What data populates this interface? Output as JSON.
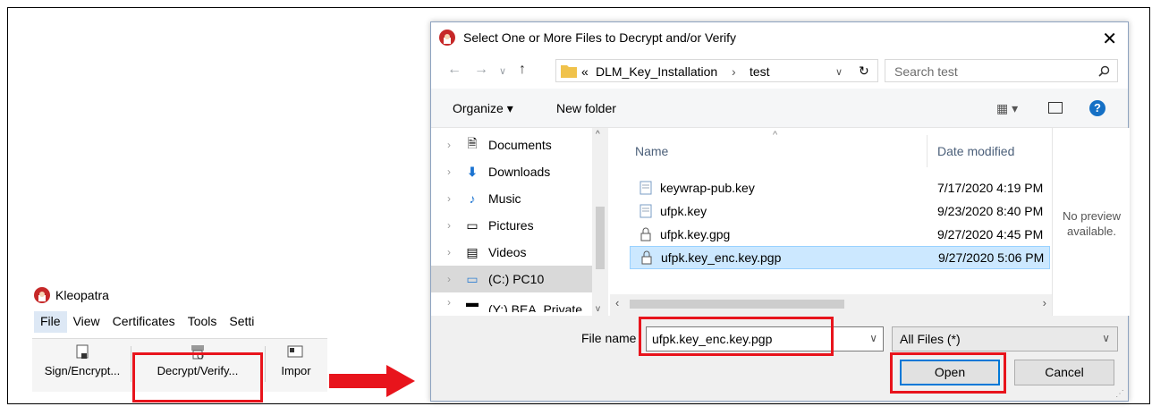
{
  "kleopatra": {
    "title": "Kleopatra",
    "menu": [
      "File",
      "View",
      "Certificates",
      "Tools",
      "Setti"
    ],
    "toolbar": {
      "sign": "Sign/Encrypt...",
      "decrypt": "Decrypt/Verify...",
      "import": "Impor"
    }
  },
  "dialog": {
    "title": "Select One or More Files to Decrypt and/or Verify",
    "address": {
      "prefix": "«",
      "path1": "DLM_Key_Installation",
      "sep": "›",
      "path2": "test"
    },
    "search_placeholder": "Search test",
    "organize": "Organize ▾",
    "new_folder": "New folder",
    "nav_items": [
      "Documents",
      "Downloads",
      "Music",
      "Pictures",
      "Videos",
      "(C:) PC10",
      "(Y:) BEA_Private"
    ],
    "columns": {
      "name": "Name",
      "date": "Date modified"
    },
    "files": [
      {
        "name": "keywrap-pub.key",
        "date": "7/17/2020 4:19 PM"
      },
      {
        "name": "ufpk.key",
        "date": "9/23/2020 8:40 PM"
      },
      {
        "name": "ufpk.key.gpg",
        "date": "9/27/2020 4:45 PM"
      },
      {
        "name": "ufpk.key_enc.key.pgp",
        "date": "9/27/2020 5:06 PM"
      }
    ],
    "preview_line1": "No preview",
    "preview_line2": "available.",
    "filename_label": "File name",
    "filename_value": "ufpk.key_enc.key.pgp",
    "filetype_value": "All Files (*)",
    "open": "Open",
    "cancel": "Cancel"
  },
  "colors": {
    "highlight_red": "#e8141c",
    "selection": "#cce8ff",
    "primary_border": "#0078d7"
  }
}
